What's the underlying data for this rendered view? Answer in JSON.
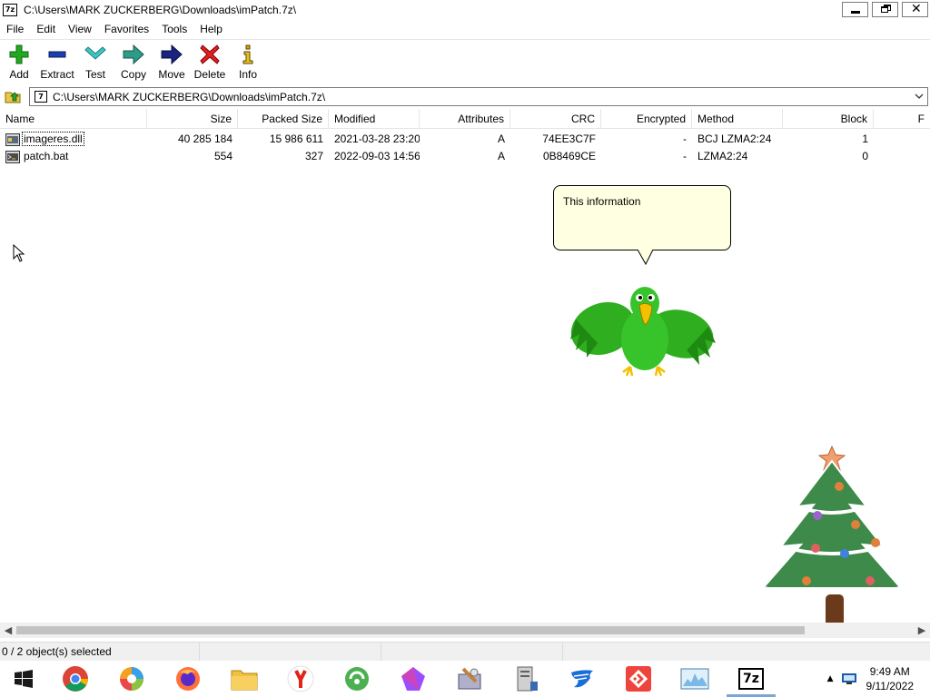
{
  "window": {
    "title": "C:\\Users\\MARK ZUCKERBERG\\Downloads\\imPatch.7z\\",
    "app_icon_text": "7z"
  },
  "menu": [
    "File",
    "Edit",
    "View",
    "Favorites",
    "Tools",
    "Help"
  ],
  "toolbar": {
    "add": "Add",
    "extract": "Extract",
    "test": "Test",
    "copy": "Copy",
    "move": "Move",
    "delete": "Delete",
    "info": "Info"
  },
  "address": {
    "path": "C:\\Users\\MARK ZUCKERBERG\\Downloads\\imPatch.7z\\"
  },
  "columns": {
    "name": "Name",
    "size": "Size",
    "packed": "Packed Size",
    "modified": "Modified",
    "attributes": "Attributes",
    "crc": "CRC",
    "encrypted": "Encrypted",
    "method": "Method",
    "block": "Block",
    "extra": "F"
  },
  "files": [
    {
      "name": "imageres.dll",
      "size": "40 285 184",
      "packed": "15 986 611",
      "modified": "2021-03-28 23:20",
      "attributes": "A",
      "crc": "74EE3C7F",
      "encrypted": "-",
      "method": "BCJ LZMA2:24",
      "block": "1"
    },
    {
      "name": "patch.bat",
      "size": "554",
      "packed": "327",
      "modified": "2022-09-03 14:56",
      "attributes": "A",
      "crc": "0B8469CE",
      "encrypted": "-",
      "method": "LZMA2:24",
      "block": "0"
    }
  ],
  "balloon": {
    "text": "This information"
  },
  "status": {
    "selected": "0 / 2 object(s) selected"
  },
  "taskbar": {
    "time": "9:49 AM",
    "date": "9/11/2022",
    "seven_zip_label": "7z"
  },
  "colors": {
    "add_green": "#22a822",
    "delete_red": "#e02020",
    "move_navy": "#1a237e",
    "balloon_bg": "#ffffe1"
  }
}
